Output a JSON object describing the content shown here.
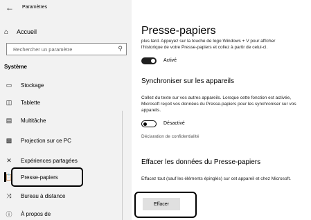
{
  "window": {
    "title": "Paramètres",
    "back_icon": "back-arrow-icon"
  },
  "sidebar": {
    "home_label": "Accueil",
    "search_placeholder": "Rechercher un paramètre",
    "section_title": "Système",
    "items": [
      {
        "label": "Stockage",
        "icon": "storage-icon"
      },
      {
        "label": "Tablette",
        "icon": "tablet-icon"
      },
      {
        "label": "Multitâche",
        "icon": "multitask-icon"
      },
      {
        "label": "Projection sur ce PC",
        "icon": "projection-icon"
      },
      {
        "label": "Expériences partagées",
        "icon": "shared-experiences-icon"
      },
      {
        "label": "Presse-papiers",
        "icon": "clipboard-icon",
        "selected": true
      },
      {
        "label": "Bureau à distance",
        "icon": "remote-desktop-icon"
      },
      {
        "label": "À propos de",
        "icon": "info-icon"
      }
    ]
  },
  "main": {
    "title": "Presse-papiers",
    "cut_text_line1": "plus tard. Appuyez sur la touche de logo Windows + V pour afficher",
    "cut_text_line2": "l'historique de votre Presse-papiers et collez à partir de celui-ci.",
    "history_toggle": {
      "state": "on",
      "label": "Activé"
    },
    "sync_title": "Synchroniser sur les appareils",
    "sync_desc": "Collez du texte sur vos autres appareils. Lorsque cette fonction est activée, Microsoft reçoit vos données du Presse-papiers pour les synchroniser sur vos appareils.",
    "sync_toggle": {
      "state": "off",
      "label": "Désactivé"
    },
    "privacy_link": "Déclaration de confidentialité",
    "clear_title": "Effacer les données du Presse-papiers",
    "clear_desc": "Effacez tout (sauf les éléments épinglés) sur cet appareil et chez Microsoft.",
    "clear_button": "Effacer"
  },
  "colors": {
    "sidebar_bg": "#f2f2f2",
    "main_bg": "#ffffff",
    "toggle_on": "#1f1f1f",
    "button_bg": "#e0e0e0"
  }
}
